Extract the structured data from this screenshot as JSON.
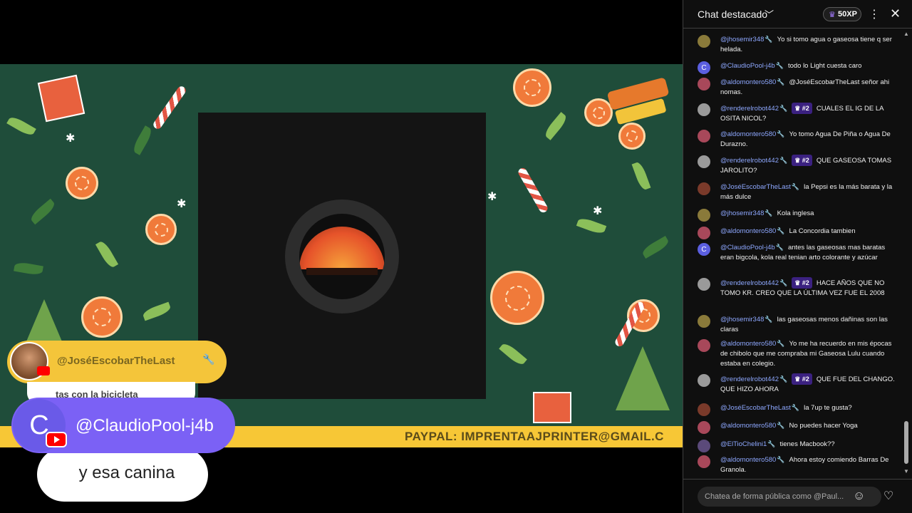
{
  "video": {
    "paypal_text": "PAYPAL: IMPRENTAAJPRINTER@GMAIL.C",
    "previous_overlay": {
      "author": "@JoséEscobarTheLast",
      "message": "tas con la bicicleta"
    },
    "current_overlay": {
      "avatar_letter": "C",
      "author": "@ClaudioPool-j4b",
      "message": "y esa canina"
    }
  },
  "chat": {
    "header": {
      "title": "Chat destacado",
      "chevron_icon": "chevron-down-icon",
      "xp_label": "50XP",
      "more_icon": "more-vert-icon",
      "close_icon": "close-icon"
    },
    "messages": [
      {
        "author": "@jhosemir348",
        "badge": "",
        "text": "Yo si tomo agua o gaseosa tiene q ser helada.",
        "avatar": "olive"
      },
      {
        "author": "@ClaudioPool-j4b",
        "badge": "",
        "text": "todo lo Light cuesta caro",
        "avatar": "C"
      },
      {
        "author": "@aldomontero580",
        "badge": "",
        "text": "@JoséEscobarTheLast señor ahi nomas.",
        "avatar": "rose"
      },
      {
        "author": "@renderelrobot442",
        "badge": "#2",
        "text": "CUALES EL IG DE LA OSITA NICOL?",
        "avatar": "gray"
      },
      {
        "author": "@aldomontero580",
        "badge": "",
        "text": "Yo tomo Agua De Piña o Agua De Durazno.",
        "avatar": "rose"
      },
      {
        "author": "@renderelrobot442",
        "badge": "#2",
        "text": "QUE GASEOSA TOMAS JAROLITO?",
        "avatar": "gray"
      },
      {
        "author": "@JoséEscobarTheLast",
        "badge": "",
        "text": "la Pepsi es la más barata y la más dulce",
        "avatar": "brown"
      },
      {
        "author": "@jhosemir348",
        "badge": "",
        "text": "Kola inglesa",
        "avatar": "olive"
      },
      {
        "author": "@aldomontero580",
        "badge": "",
        "text": "La Concordia tambien",
        "avatar": "rose"
      },
      {
        "author": "@ClaudioPool-j4b",
        "badge": "",
        "text": "antes las gaseosas mas baratas eran bigcola, kola real tenian arto colorante y azúcar",
        "avatar": "C"
      },
      {
        "author": "@renderelrobot442",
        "badge": "#2",
        "text": "HACE AÑOS QUE NO TOMO KR. CREO QUE LA ÚLTIMA VEZ FUE EL 2008",
        "avatar": "gray"
      },
      {
        "author": "@jhosemir348",
        "badge": "",
        "text": "las gaseosas menos dañinas son las claras",
        "avatar": "olive"
      },
      {
        "author": "@aldomontero580",
        "badge": "",
        "text": "Yo me ha recuerdo en mis épocas de chibolo que me compraba mi Gaseosa Lulu cuando estaba en colegio.",
        "avatar": "rose"
      },
      {
        "author": "@renderelrobot442",
        "badge": "#2",
        "text": "QUE FUE DEL CHANGO. QUE HIZO AHORA",
        "avatar": "gray"
      },
      {
        "author": "@JoséEscobarTheLast",
        "badge": "",
        "text": "la 7up te gusta?",
        "avatar": "brown"
      },
      {
        "author": "@aldomontero580",
        "badge": "",
        "text": "No puedes hacer Yoga",
        "avatar": "rose"
      },
      {
        "author": "@ElTioChelini1",
        "badge": "",
        "text": "tienes Macbook??",
        "avatar": "purple"
      },
      {
        "author": "@aldomontero580",
        "badge": "",
        "text": "Ahora estoy comiendo Barras De Granola.",
        "avatar": "rose"
      }
    ],
    "input": {
      "placeholder": "Chatea de forma pública como @Paul...",
      "emoji_icon": "emoji-icon",
      "heart_icon": "heart-icon"
    }
  }
}
